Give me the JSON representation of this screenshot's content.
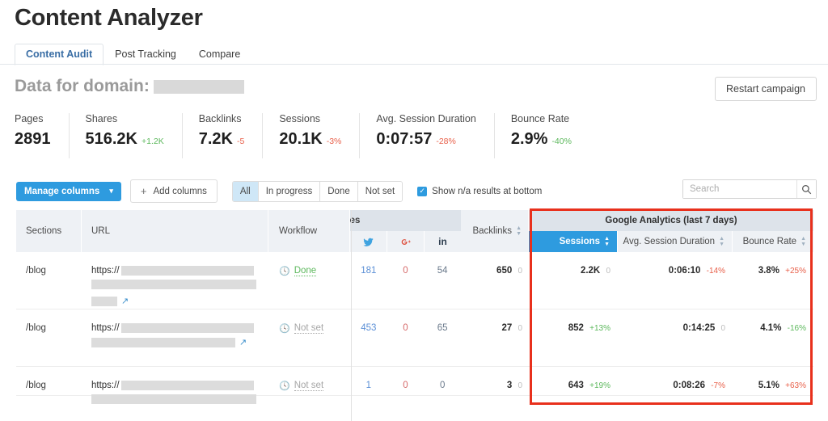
{
  "header": {
    "title": "Content Analyzer",
    "tabs": [
      {
        "label": "Content Audit",
        "active": true
      },
      {
        "label": "Post Tracking",
        "active": false
      },
      {
        "label": "Compare",
        "active": false
      }
    ],
    "domain_label": "Data for domain:",
    "restart_button": "Restart campaign"
  },
  "metrics": [
    {
      "label": "Pages",
      "value": "2891",
      "delta": "",
      "delta_dir": "none"
    },
    {
      "label": "Shares",
      "value": "516.2K",
      "delta": "+1.2K",
      "delta_dir": "up"
    },
    {
      "label": "Backlinks",
      "value": "7.2K",
      "delta": "-5",
      "delta_dir": "down"
    },
    {
      "label": "Sessions",
      "value": "20.1K",
      "delta": "-3%",
      "delta_dir": "down"
    },
    {
      "label": "Avg. Session Duration",
      "value": "0:07:57",
      "delta": "-28%",
      "delta_dir": "down"
    },
    {
      "label": "Bounce Rate",
      "value": "2.9%",
      "delta": "-40%",
      "delta_dir": "up"
    }
  ],
  "toolbar": {
    "manage_columns": "Manage columns",
    "manage_caret": "▾",
    "add_columns": "Add columns",
    "add_plus": "+",
    "filters": [
      {
        "label": "All",
        "active": true
      },
      {
        "label": "In progress",
        "active": false
      },
      {
        "label": "Done",
        "active": false
      },
      {
        "label": "Not set",
        "active": false
      }
    ],
    "checkbox_label": "Show n/a results at bottom",
    "checkbox_checked": true,
    "checkbox_glyph": "✓"
  },
  "search": {
    "placeholder": "Search",
    "value": "",
    "icon": "search-icon"
  },
  "table": {
    "columns": {
      "sections": "Sections",
      "url": "URL",
      "workflow": "Workflow",
      "shares_group": "Shares",
      "shares_group_visible": "res",
      "shares_sub": [
        "twitter-icon",
        "googleplus-icon",
        "linkedin-icon"
      ],
      "backlinks": "Backlinks",
      "ga_group": "Google Analytics (last 7 days)",
      "ga_sub": [
        "Sessions",
        "Avg. Session Duration",
        "Bounce Rate"
      ]
    },
    "rows": [
      {
        "section": "/blog",
        "url_proto": "https://",
        "workflow": "Done",
        "workflow_state": "done",
        "shares": [
          {
            "value": "181",
            "style": "blue"
          },
          {
            "value": "0",
            "style": "red"
          },
          {
            "value": "54",
            "style": "grey"
          }
        ],
        "backlinks": {
          "value": "650",
          "delta": "0",
          "delta_dir": "none"
        },
        "sessions": {
          "value": "2.2K",
          "delta": "0",
          "delta_dir": "none"
        },
        "duration": {
          "value": "0:06:10",
          "delta": "-14%",
          "delta_dir": "down"
        },
        "bounce": {
          "value": "3.8%",
          "delta": "+25%",
          "delta_dir": "down"
        }
      },
      {
        "section": "/blog",
        "url_proto": "https://",
        "workflow": "Not set",
        "workflow_state": "notset",
        "shares": [
          {
            "value": "453",
            "style": "blue"
          },
          {
            "value": "0",
            "style": "red"
          },
          {
            "value": "65",
            "style": "grey"
          }
        ],
        "backlinks": {
          "value": "27",
          "delta": "0",
          "delta_dir": "none"
        },
        "sessions": {
          "value": "852",
          "delta": "+13%",
          "delta_dir": "up"
        },
        "duration": {
          "value": "0:14:25",
          "delta": "0",
          "delta_dir": "none"
        },
        "bounce": {
          "value": "4.1%",
          "delta": "-16%",
          "delta_dir": "up"
        }
      },
      {
        "section": "/blog",
        "url_proto": "https://",
        "workflow": "Not set",
        "workflow_state": "notset",
        "shares": [
          {
            "value": "1",
            "style": "blue"
          },
          {
            "value": "0",
            "style": "red"
          },
          {
            "value": "0",
            "style": "grey"
          }
        ],
        "backlinks": {
          "value": "3",
          "delta": "0",
          "delta_dir": "none"
        },
        "sessions": {
          "value": "643",
          "delta": "+19%",
          "delta_dir": "up"
        },
        "duration": {
          "value": "0:08:26",
          "delta": "-7%",
          "delta_dir": "down"
        },
        "bounce": {
          "value": "5.1%",
          "delta": "+63%",
          "delta_dir": "down"
        }
      }
    ]
  },
  "annotation": {
    "highlight_color": "#e8301c",
    "target": "google-analytics-columns"
  },
  "colors": {
    "accent_blue": "#2e9bdf",
    "tab_active": "#3a6ea5",
    "positive": "#5cb85c",
    "negative": "#e8604a",
    "header_bg": "#eef1f5",
    "group_header_bg": "#dde3ea"
  }
}
